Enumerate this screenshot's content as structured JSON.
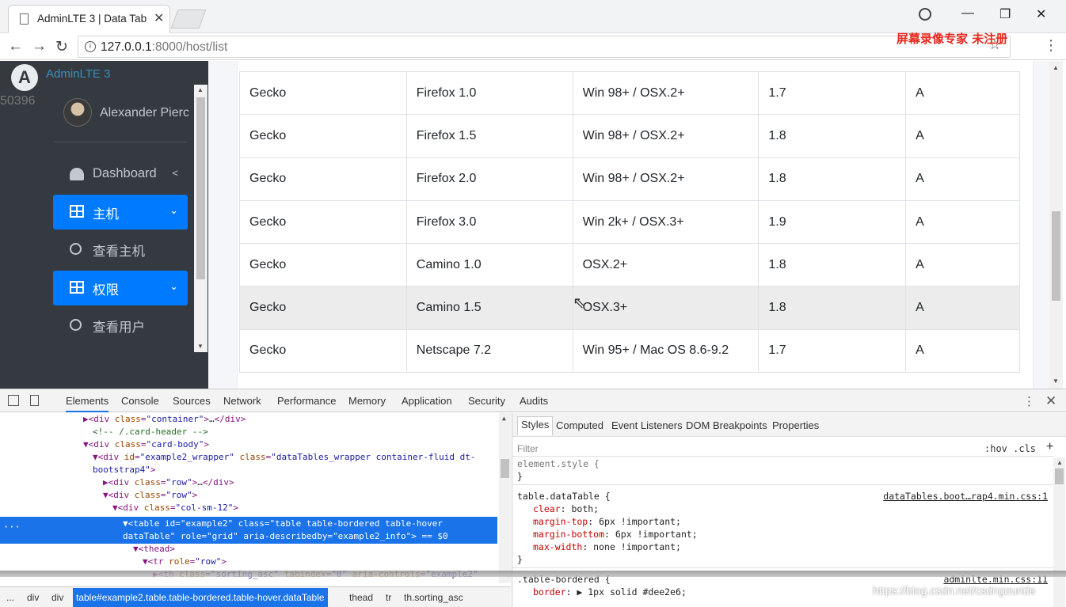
{
  "browser": {
    "tab_title": "AdminLTE 3 | Data Tab",
    "url_host": "127.0.0.1",
    "url_path": ":8000/host/list",
    "watermark": "屏幕录像专家 未注册"
  },
  "sidebar": {
    "brand": "AdminLTE 3",
    "stray": "50396",
    "user_name": "Alexander Pierce",
    "items": [
      {
        "label": "Dashboard",
        "icon": "dashboard-icon",
        "active": false
      },
      {
        "label": "主机",
        "icon": "table-icon",
        "active": true
      },
      {
        "label": "查看主机",
        "icon": "circle-icon",
        "active": false
      },
      {
        "label": "权限",
        "icon": "table-icon",
        "active": true
      },
      {
        "label": "查看用户",
        "icon": "circle-icon",
        "active": false
      }
    ]
  },
  "table": {
    "rows": [
      [
        "Gecko",
        "Firefox 1.0",
        "Win 98+ / OSX.2+",
        "1.7",
        "A"
      ],
      [
        "Gecko",
        "Firefox 1.5",
        "Win 98+ / OSX.2+",
        "1.8",
        "A"
      ],
      [
        "Gecko",
        "Firefox 2.0",
        "Win 98+ / OSX.2+",
        "1.8",
        "A"
      ],
      [
        "Gecko",
        "Firefox 3.0",
        "Win 2k+ / OSX.3+",
        "1.9",
        "A"
      ],
      [
        "Gecko",
        "Camino 1.0",
        "OSX.2+",
        "1.8",
        "A"
      ],
      [
        "Gecko",
        "Camino 1.5",
        "OSX.3+",
        "1.8",
        "A"
      ],
      [
        "Gecko",
        "Netscape 7.2",
        "Win 95+ / Mac OS 8.6-9.2",
        "1.7",
        "A"
      ]
    ],
    "hover_row": 5
  },
  "devtools": {
    "tabs": [
      "Elements",
      "Console",
      "Sources",
      "Network",
      "Performance",
      "Memory",
      "Application",
      "Security",
      "Audits"
    ],
    "selected_tab": "Elements",
    "style_tabs": [
      "Styles",
      "Computed",
      "Event Listeners",
      "DOM Breakpoints",
      "Properties"
    ],
    "filter_placeholder": "Filter",
    "hov_cls": ":hov  .cls",
    "element_style": "element.style {",
    "rule1_selector": "table.dataTable {",
    "rule1_source": "dataTables.boot…rap4.min.css:1",
    "rule1_props": [
      {
        "p": "clear",
        "v": "both;"
      },
      {
        "p": "margin-top",
        "v": "6px !important;"
      },
      {
        "p": "margin-bottom",
        "v": "6px !important;"
      },
      {
        "p": "max-width",
        "v": "none !important;"
      }
    ],
    "rule2_selector": ".table-bordered {",
    "rule2_source": "adminlte.min.css:11",
    "rule2_prop": "border",
    "rule2_value": "1px solid  #dee2e6;",
    "close_brace": "}",
    "breadcrumbs": [
      "...",
      "div",
      "div",
      "table#example2.table.table-bordered.table-hover.dataTable",
      "thead",
      "tr",
      "th.sorting_asc"
    ],
    "csdn": "https://blog.csdn.net/csdngouride"
  }
}
